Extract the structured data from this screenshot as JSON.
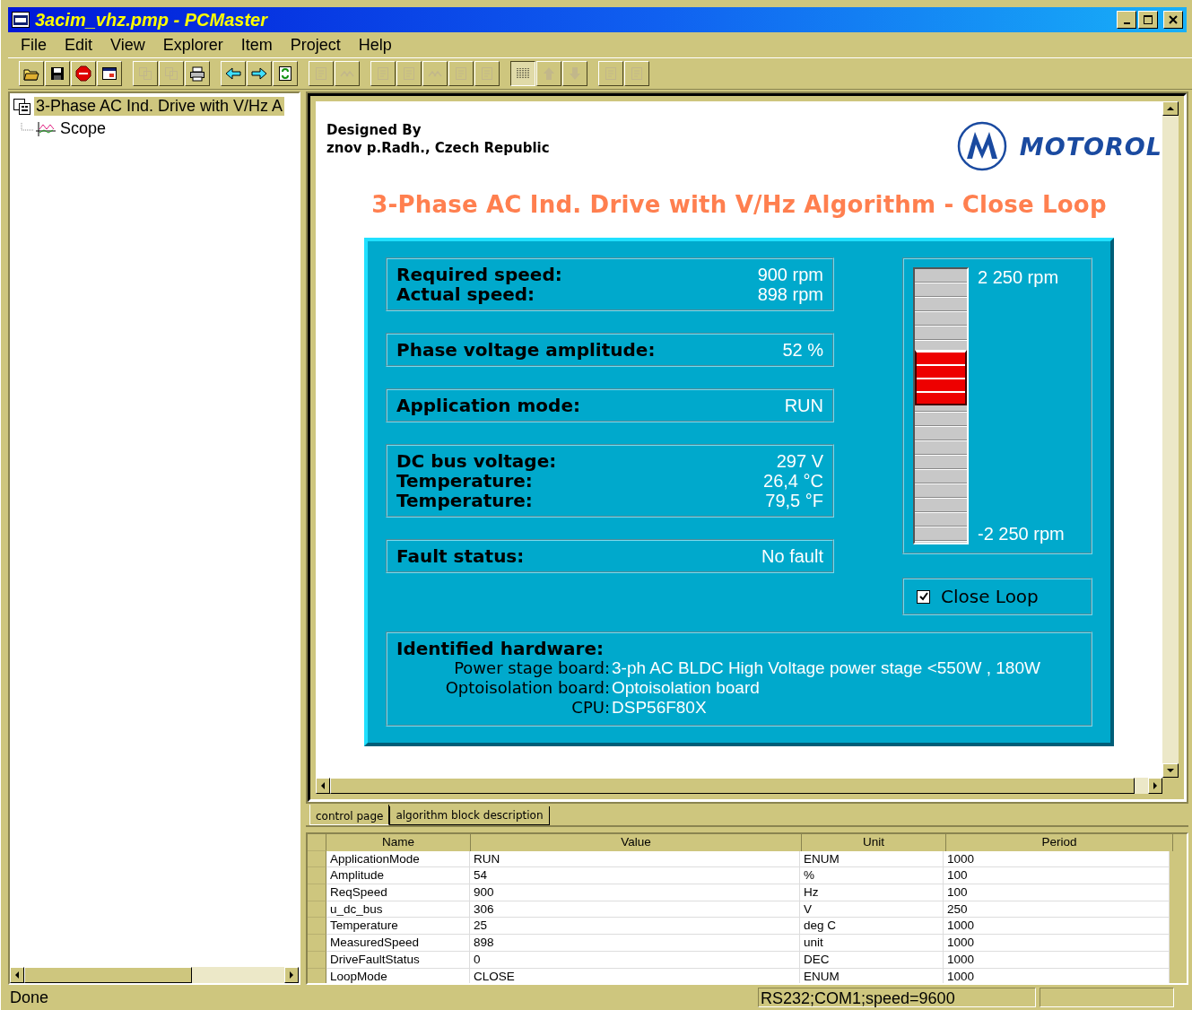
{
  "window": {
    "title": "3acim_vhz.pmp - PCMaster"
  },
  "menu": [
    "File",
    "Edit",
    "View",
    "Explorer",
    "Item",
    "Project",
    "Help"
  ],
  "toolbar": [
    [
      {
        "kind": "folder",
        "disabled": false,
        "pressed": false
      },
      {
        "kind": "disk",
        "disabled": false,
        "pressed": false
      },
      {
        "kind": "stop",
        "disabled": false,
        "pressed": false
      },
      {
        "kind": "window",
        "disabled": false,
        "pressed": false
      }
    ],
    [
      {
        "kind": "copy",
        "disabled": true,
        "pressed": false
      },
      {
        "kind": "copy",
        "disabled": true,
        "pressed": false
      },
      {
        "kind": "printer",
        "disabled": false,
        "pressed": false
      }
    ],
    [
      {
        "kind": "arrow-left",
        "disabled": false,
        "pressed": false
      },
      {
        "kind": "arrow-right",
        "disabled": false,
        "pressed": false
      },
      {
        "kind": "refresh",
        "disabled": false,
        "pressed": false
      }
    ],
    [
      {
        "kind": "document",
        "disabled": true,
        "pressed": false
      },
      {
        "kind": "chevrons",
        "disabled": true,
        "pressed": false
      }
    ],
    [
      {
        "kind": "document",
        "disabled": true,
        "pressed": false
      },
      {
        "kind": "document",
        "disabled": true,
        "pressed": false
      },
      {
        "kind": "chevrons",
        "disabled": true,
        "pressed": false
      },
      {
        "kind": "document",
        "disabled": true,
        "pressed": false
      },
      {
        "kind": "document",
        "disabled": true,
        "pressed": false
      }
    ],
    [
      {
        "kind": "grid",
        "disabled": false,
        "pressed": true
      },
      {
        "kind": "arrow-up",
        "disabled": true,
        "pressed": false
      },
      {
        "kind": "arrow-down",
        "disabled": true,
        "pressed": false
      }
    ],
    [
      {
        "kind": "document",
        "disabled": true,
        "pressed": false
      },
      {
        "kind": "document",
        "disabled": true,
        "pressed": false
      }
    ]
  ],
  "tree": [
    {
      "label": "3-Phase AC Ind. Drive with V/Hz A",
      "selected": true,
      "children": [
        {
          "label": "Scope",
          "selected": false
        }
      ]
    }
  ],
  "page": {
    "credit": [
      "Designed By",
      "znov p.Radh., Czech Republic"
    ],
    "logo": "MOTOROL",
    "heading": "3-Phase AC Ind. Drive with V/Hz Algorithm - Close Loop",
    "panels": [
      {
        "rows": [
          {
            "label": "Required speed:",
            "value": "900 rpm"
          },
          {
            "label": "Actual speed:",
            "value": "898 rpm"
          }
        ]
      },
      {
        "rows": [
          {
            "label": "Phase voltage amplitude:",
            "value": "52 %"
          }
        ]
      },
      {
        "rows": [
          {
            "label": "Application mode:",
            "value": "RUN"
          }
        ]
      },
      {
        "rows": [
          {
            "label": "DC bus voltage:",
            "value": "297 V"
          },
          {
            "label": "Temperature:",
            "value": "26,4 °C"
          },
          {
            "label": "Temperature:",
            "value": "79,5 °F"
          }
        ]
      },
      {
        "rows": [
          {
            "label": "Fault status:",
            "value": "No fault"
          }
        ]
      }
    ],
    "speed_gauge": {
      "max": "2 250 rpm",
      "min": "-2 250 rpm",
      "level": 0.63
    },
    "close_loop": {
      "label": "Close Loop",
      "checked": true
    },
    "hardware": {
      "title": "Identified hardware:",
      "rows": [
        {
          "label": "Power stage board:",
          "value": "3-ph AC BLDC High Voltage power stage <550W , 180W"
        },
        {
          "label": "Optoisolation board:",
          "value": "Optoisolation board"
        },
        {
          "label": "CPU:",
          "value": "DSP56F80X"
        }
      ]
    }
  },
  "tabs": [
    {
      "label": "control page",
      "selected": true
    },
    {
      "label": "algorithm block description",
      "selected": false
    }
  ],
  "table": {
    "columns": [
      "Name",
      "Value",
      "Unit",
      "Period"
    ],
    "rows": [
      [
        "ApplicationMode",
        "RUN",
        "ENUM",
        "1000"
      ],
      [
        "Amplitude",
        "54",
        "%",
        "100"
      ],
      [
        "ReqSpeed",
        "900",
        "Hz",
        "100"
      ],
      [
        "u_dc_bus",
        "306",
        "V",
        "250"
      ],
      [
        "Temperature",
        "25",
        "deg C",
        "1000"
      ],
      [
        "MeasuredSpeed",
        "898",
        "unit",
        "1000"
      ],
      [
        "DriveFaultStatus",
        "0",
        "DEC",
        "1000"
      ],
      [
        "LoopMode",
        "CLOSE",
        "ENUM",
        "1000"
      ]
    ]
  },
  "status_bar": [
    "Done",
    "RS232;COM1;speed=9600"
  ]
}
